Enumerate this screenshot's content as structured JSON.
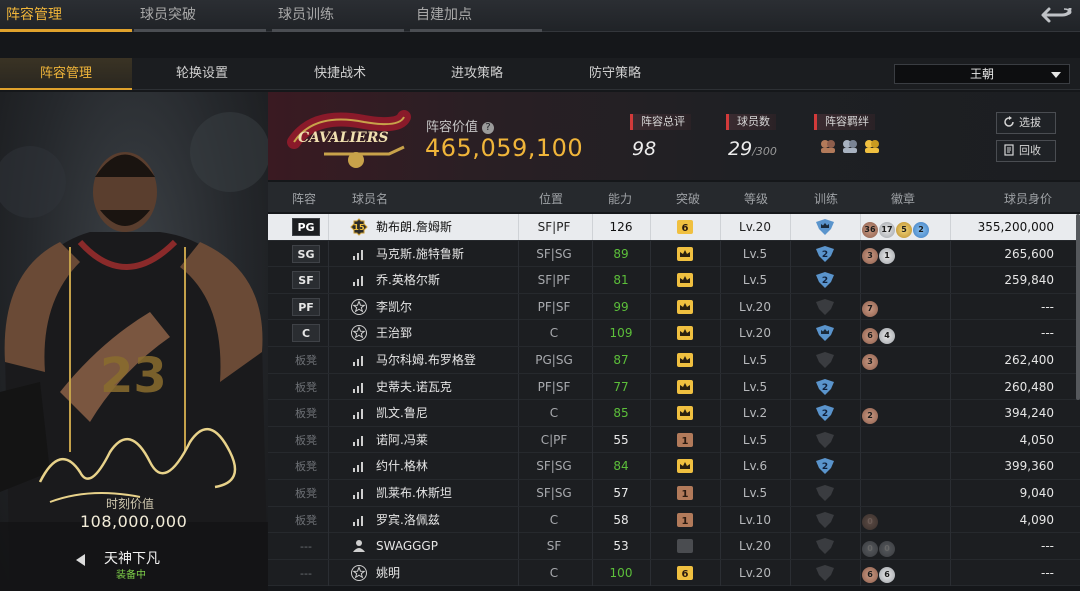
{
  "top_tabs": [
    {
      "label": "阵容管理",
      "active": true
    },
    {
      "label": "球员突破",
      "active": false
    },
    {
      "label": "球员训练",
      "active": false
    },
    {
      "label": "自建加点",
      "active": false
    }
  ],
  "sub_tabs": [
    {
      "label": "阵容管理",
      "active": true
    },
    {
      "label": "轮换设置",
      "active": false
    },
    {
      "label": "快捷战术",
      "active": false
    },
    {
      "label": "进攻策略",
      "active": false
    },
    {
      "label": "防守策略",
      "active": false
    }
  ],
  "team_select": {
    "value": "王朝"
  },
  "card": {
    "value_label": "时刻价值",
    "value": "108,000,000",
    "card_name": "天神下凡",
    "equipped": "装备中",
    "jersey_number": "23"
  },
  "team": {
    "lineup_value_label": "阵容价值",
    "lineup_value": "465,059,100",
    "rating_label": "阵容总评",
    "rating": "98",
    "count_label": "球员数",
    "count": "29",
    "count_max": "/300",
    "bond_label": "阵容羁绊",
    "logo_text": "CAVALIERS",
    "select_btn": "选拔",
    "recycle_btn": "回收"
  },
  "columns": [
    "阵容",
    "球员名",
    "位置",
    "能力",
    "突破",
    "等级",
    "训练",
    "徽章",
    "球员身价"
  ],
  "players": [
    {
      "slot": "PG",
      "starter": true,
      "icon": "level15",
      "name": "勒布朗.詹姆斯",
      "pos": "SF|PF",
      "ability": "126",
      "ability_color": "white",
      "break": "6",
      "break_type": "gold",
      "level": "Lv.20",
      "train": "crown",
      "badges": [
        {
          "t": "bronze",
          "v": "36"
        },
        {
          "t": "silver",
          "v": "17"
        },
        {
          "t": "gold",
          "v": "5"
        },
        {
          "t": "blue",
          "v": "2"
        }
      ],
      "price": "355,200,000",
      "selected": true
    },
    {
      "slot": "SG",
      "starter": true,
      "icon": "bars",
      "name": "马克斯.施特鲁斯",
      "pos": "SF|SG",
      "ability": "89",
      "ability_color": "green",
      "break": "",
      "break_type": "crown",
      "level": "Lv.5",
      "train": "2",
      "badges": [
        {
          "t": "bronze",
          "v": "3"
        },
        {
          "t": "silver",
          "v": "1"
        }
      ],
      "price": "265,600"
    },
    {
      "slot": "SF",
      "starter": true,
      "icon": "bars",
      "name": "乔.英格尔斯",
      "pos": "SF|PF",
      "ability": "81",
      "ability_color": "green",
      "break": "",
      "break_type": "crown",
      "level": "Lv.5",
      "train": "2",
      "badges": [],
      "price": "259,840"
    },
    {
      "slot": "PF",
      "starter": true,
      "icon": "star",
      "name": "李凯尔",
      "pos": "PF|SF",
      "ability": "99",
      "ability_color": "green",
      "break": "",
      "break_type": "crown",
      "level": "Lv.20",
      "train": "none",
      "badges": [
        {
          "t": "bronze",
          "v": "7"
        }
      ],
      "price": "---"
    },
    {
      "slot": "C",
      "starter": true,
      "icon": "star",
      "name": "王治郅",
      "pos": "C",
      "ability": "109",
      "ability_color": "green",
      "break": "",
      "break_type": "crown",
      "level": "Lv.20",
      "train": "crown",
      "badges": [
        {
          "t": "bronze",
          "v": "6"
        },
        {
          "t": "silver",
          "v": "4"
        }
      ],
      "price": "---"
    },
    {
      "slot": "板凳",
      "starter": false,
      "icon": "bars",
      "name": "马尔科姆.布罗格登",
      "pos": "PG|SG",
      "ability": "87",
      "ability_color": "green",
      "break": "",
      "break_type": "crown",
      "level": "Lv.5",
      "train": "none",
      "badges": [
        {
          "t": "bronze",
          "v": "3"
        }
      ],
      "price": "262,400"
    },
    {
      "slot": "板凳",
      "starter": false,
      "icon": "bars",
      "name": "史蒂夫.诺瓦克",
      "pos": "PF|SF",
      "ability": "77",
      "ability_color": "green",
      "break": "",
      "break_type": "crown",
      "level": "Lv.5",
      "train": "2",
      "badges": [],
      "price": "260,480"
    },
    {
      "slot": "板凳",
      "starter": false,
      "icon": "bars",
      "name": "凯文.鲁尼",
      "pos": "C",
      "ability": "85",
      "ability_color": "green",
      "break": "",
      "break_type": "crown",
      "level": "Lv.2",
      "train": "2",
      "badges": [
        {
          "t": "bronze",
          "v": "2"
        }
      ],
      "price": "394,240"
    },
    {
      "slot": "板凳",
      "starter": false,
      "icon": "bars",
      "name": "诺阿.冯莱",
      "pos": "C|PF",
      "ability": "55",
      "ability_color": "white",
      "break": "1",
      "break_type": "bronze",
      "level": "Lv.5",
      "train": "none",
      "badges": [],
      "price": "4,050"
    },
    {
      "slot": "板凳",
      "starter": false,
      "icon": "bars",
      "name": "约什.格林",
      "pos": "SF|SG",
      "ability": "84",
      "ability_color": "green",
      "break": "",
      "break_type": "crown",
      "level": "Lv.6",
      "train": "2",
      "badges": [],
      "price": "399,360"
    },
    {
      "slot": "板凳",
      "starter": false,
      "icon": "bars",
      "name": "凯莱布.休斯坦",
      "pos": "SF|SG",
      "ability": "57",
      "ability_color": "white",
      "break": "1",
      "break_type": "bronze",
      "level": "Lv.5",
      "train": "none",
      "badges": [],
      "price": "9,040"
    },
    {
      "slot": "板凳",
      "starter": false,
      "icon": "bars",
      "name": "罗宾.洛佩兹",
      "pos": "C",
      "ability": "58",
      "ability_color": "white",
      "break": "1",
      "break_type": "bronze",
      "level": "Lv.10",
      "train": "none",
      "badges": [
        {
          "t": "dark",
          "v": "0"
        }
      ],
      "price": "4,090"
    },
    {
      "slot": "---",
      "starter": false,
      "icon": "person",
      "name": "SWAGGGP",
      "pos": "SF",
      "ability": "53",
      "ability_color": "white",
      "break": "",
      "break_type": "grey",
      "level": "Lv.20",
      "train": "none",
      "badges": [
        {
          "t": "grey",
          "v": "0"
        },
        {
          "t": "grey",
          "v": "0"
        }
      ],
      "price": "---"
    },
    {
      "slot": "---",
      "starter": false,
      "icon": "star",
      "name": "姚明",
      "pos": "C",
      "ability": "100",
      "ability_color": "green",
      "break": "6",
      "break_type": "gold",
      "level": "Lv.20",
      "train": "none",
      "badges": [
        {
          "t": "bronze",
          "v": "6"
        },
        {
          "t": "silver",
          "v": "6"
        }
      ],
      "price": "---"
    }
  ]
}
